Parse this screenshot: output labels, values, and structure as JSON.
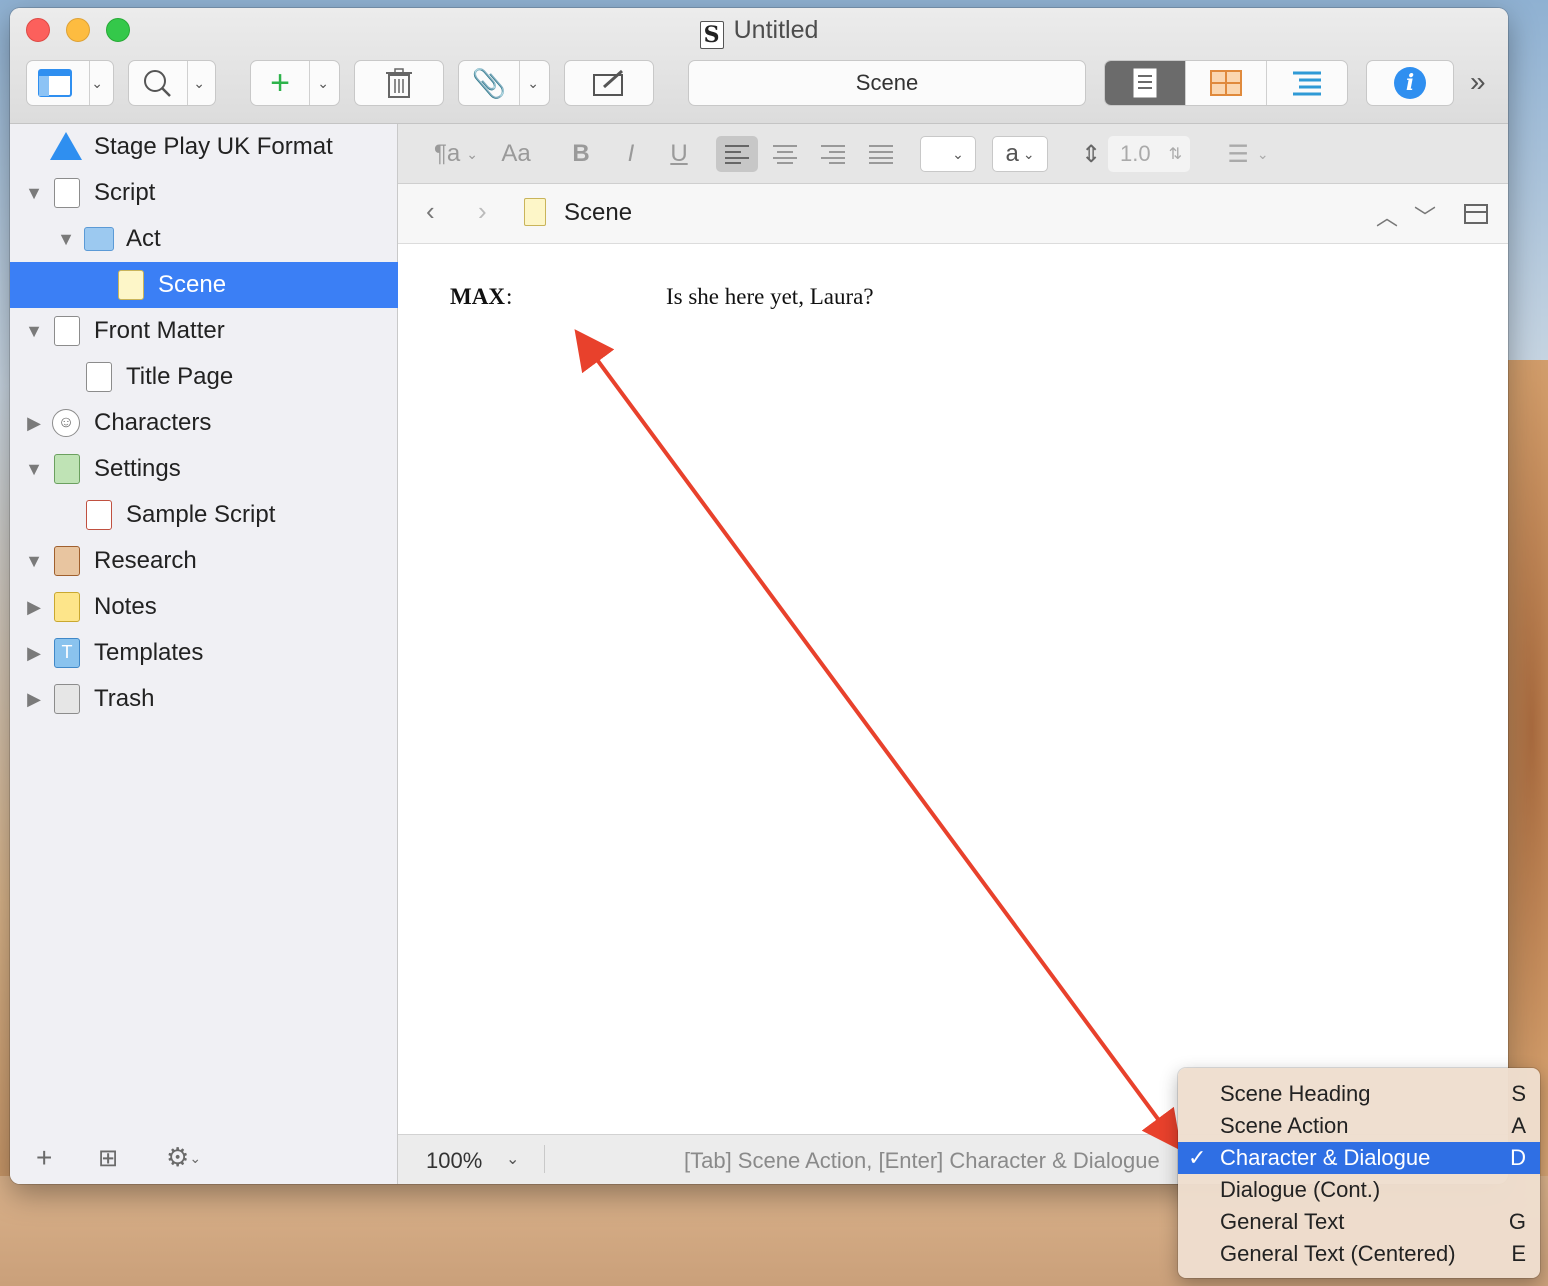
{
  "window": {
    "title": "Untitled"
  },
  "toolbar": {
    "scene_field": "Scene"
  },
  "format_bar": {
    "line_spacing": "1.0",
    "font_size_label": "a",
    "styles_label": "¶a",
    "fonts_label": "Aa",
    "bold": "B",
    "italic": "I",
    "underline": "U"
  },
  "binder": {
    "items": [
      {
        "label": "Stage Play UK Format"
      },
      {
        "label": "Script"
      },
      {
        "label": "Act"
      },
      {
        "label": "Scene"
      },
      {
        "label": "Front Matter"
      },
      {
        "label": "Title Page"
      },
      {
        "label": "Characters"
      },
      {
        "label": "Settings"
      },
      {
        "label": "Sample Script"
      },
      {
        "label": "Research"
      },
      {
        "label": "Notes"
      },
      {
        "label": "Templates"
      },
      {
        "label": "Trash"
      }
    ],
    "templates_icon_letter": "T"
  },
  "header": {
    "title": "Scene"
  },
  "editor": {
    "character": "MAX",
    "colon": ":",
    "dialogue": "Is she here yet, Laura?"
  },
  "footer": {
    "zoom": "100%",
    "hint": "[Tab] Scene Action, [Enter] Character & Dialogue"
  },
  "menu": {
    "items": [
      {
        "label": "Scene Heading",
        "key": "S",
        "check": ""
      },
      {
        "label": "Scene Action",
        "key": "A",
        "check": ""
      },
      {
        "label": "Character & Dialogue",
        "key": "D",
        "check": "✓"
      },
      {
        "label": "Dialogue (Cont.)",
        "key": "",
        "check": ""
      },
      {
        "label": "General Text",
        "key": "G",
        "check": ""
      },
      {
        "label": "General Text (Centered)",
        "key": "E",
        "check": ""
      }
    ]
  },
  "colors": {
    "selection": "#3b7ff5",
    "menu_selection": "#2f6fe4",
    "annotation_arrow": "#e8412c"
  }
}
